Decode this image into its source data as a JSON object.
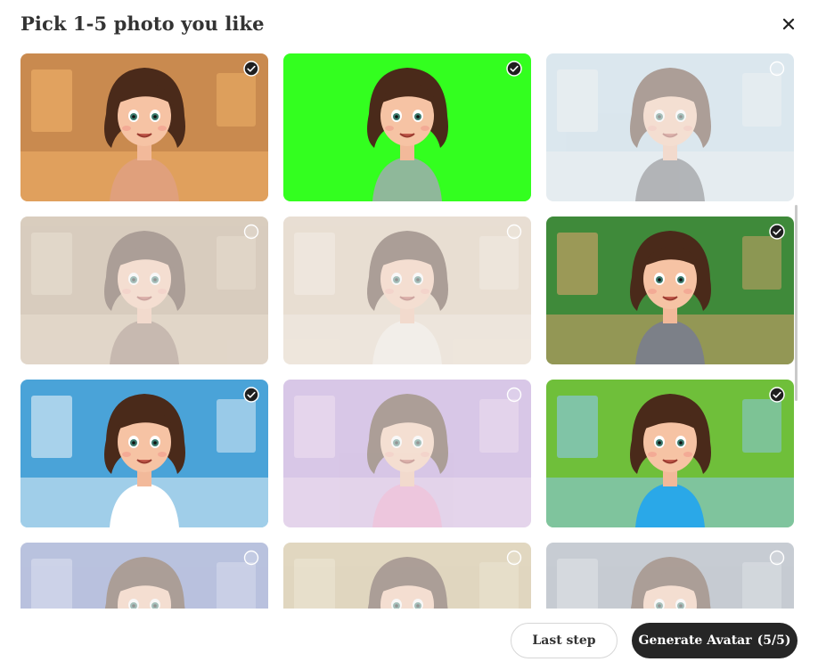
{
  "dialog": {
    "title": "Pick 1-5 photo you like",
    "close_icon": "close-icon"
  },
  "photos": [
    {
      "scene": "cozy-living-room",
      "bg": "#c98a4f",
      "accent": "#f2b36a",
      "shirt": "#e0a07c",
      "selected": true
    },
    {
      "scene": "green-screen",
      "bg": "#33ff1f",
      "accent": "#33ff1f",
      "shirt": "#8fb89a",
      "selected": true
    },
    {
      "scene": "city-office",
      "bg": "#b9d6e6",
      "accent": "#e8eef2",
      "shirt": "#5a5f66",
      "selected": false
    },
    {
      "scene": "school-hallway",
      "bg": "#b59876",
      "accent": "#d9c3a4",
      "shirt": "#8b6a55",
      "selected": false
    },
    {
      "scene": "bright-room",
      "bg": "#d9c2a6",
      "accent": "#f1e3d0",
      "shirt": "#f2e8dc",
      "selected": false
    },
    {
      "scene": "classroom",
      "bg": "#3f8a3a",
      "accent": "#d9a36b",
      "shirt": "#7c8088",
      "selected": true
    },
    {
      "scene": "doctor-office",
      "bg": "#4aa3d8",
      "accent": "#e8f2f8",
      "shirt": "#ffffff",
      "selected": true
    },
    {
      "scene": "purple-room",
      "bg": "#b28ad6",
      "accent": "#e7c2ea",
      "shirt": "#e58ac0",
      "selected": false
    },
    {
      "scene": "mountain-lake",
      "bg": "#6fbf3a",
      "accent": "#8cc8ef",
      "shirt": "#2aa8e8",
      "selected": true
    },
    {
      "scene": "tech-screen",
      "bg": "#6a7ec2",
      "accent": "#b7c2e8",
      "shirt": "#6b6f8a",
      "selected": false
    },
    {
      "scene": "wooden-fence",
      "bg": "#c8b07a",
      "accent": "#e2d3a8",
      "shirt": "#9c7a55",
      "selected": false
    },
    {
      "scene": "spaceship",
      "bg": "#8a96a6",
      "accent": "#c4ccd6",
      "shirt": "#7b818c",
      "selected": false
    }
  ],
  "footer": {
    "last_step_label": "Last step",
    "generate_label": "Generate Avatar",
    "generate_count": "(5/5)"
  }
}
